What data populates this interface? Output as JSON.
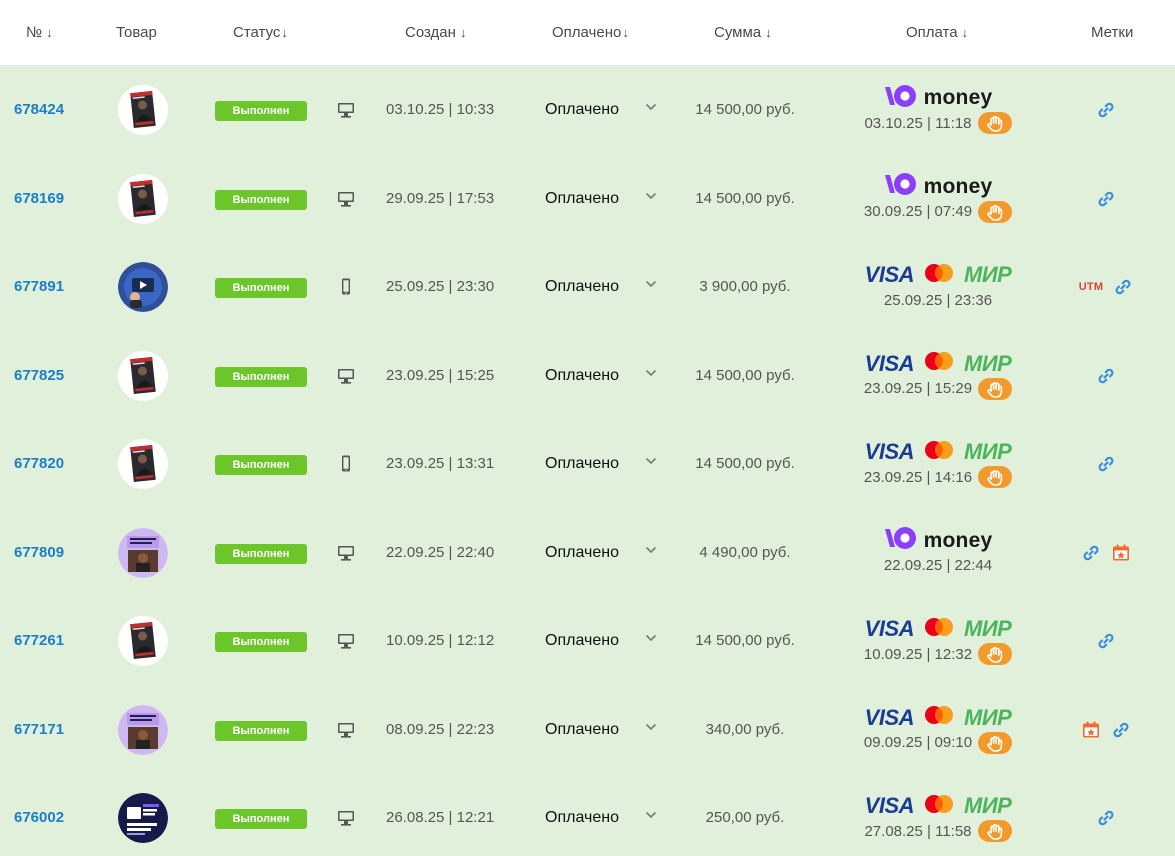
{
  "header": {
    "num": "№",
    "product": "Товар",
    "status": "Статус",
    "created": "Создан",
    "paid": "Оплачено",
    "sum": "Сумма",
    "payment": "Оплата",
    "tags": "Метки",
    "sort_arrow": "↓"
  },
  "colors": {
    "row_bg": "#e1f0da",
    "link": "#1a7fc8",
    "status_green": "#6cc62a",
    "hand_orange": "#f39a2d",
    "ymoney_purple": "#8b3ffd",
    "visa_blue": "#1a3c93",
    "mir_green": "#4db45e",
    "utm_red": "#d7453c"
  },
  "payment_logo_text": {
    "ymoney": "money",
    "visa": "VISA",
    "mir": "МИР",
    "utm": "UTM"
  },
  "rows": [
    {
      "id": "678424",
      "thumb": "book-cover",
      "status": "Выполнен",
      "device": "desktop",
      "created": "03.10.25 | 10:33",
      "paid": "Оплачено",
      "sum": "14 500,00 руб.",
      "method": "ymoney",
      "pay_date": "03.10.25 | 11:18",
      "hand": true,
      "tags": [
        "link"
      ]
    },
    {
      "id": "678169",
      "thumb": "book-cover",
      "status": "Выполнен",
      "device": "desktop",
      "created": "29.09.25 | 17:53",
      "paid": "Оплачено",
      "sum": "14 500,00 руб.",
      "method": "ymoney",
      "pay_date": "30.09.25 | 07:49",
      "hand": true,
      "tags": [
        "link"
      ]
    },
    {
      "id": "677891",
      "thumb": "blue-video",
      "status": "Выполнен",
      "device": "mobile",
      "created": "25.09.25 | 23:30",
      "paid": "Оплачено",
      "sum": "3 900,00 руб.",
      "method": "cards",
      "pay_date": "25.09.25 | 23:36",
      "hand": false,
      "tags": [
        "utm",
        "link"
      ]
    },
    {
      "id": "677825",
      "thumb": "book-cover",
      "status": "Выполнен",
      "device": "desktop",
      "created": "23.09.25 | 15:25",
      "paid": "Оплачено",
      "sum": "14 500,00 руб.",
      "method": "cards",
      "pay_date": "23.09.25 | 15:29",
      "hand": true,
      "tags": [
        "link"
      ]
    },
    {
      "id": "677820",
      "thumb": "book-cover",
      "status": "Выполнен",
      "device": "mobile",
      "created": "23.09.25 | 13:31",
      "paid": "Оплачено",
      "sum": "14 500,00 руб.",
      "method": "cards",
      "pay_date": "23.09.25 | 14:16",
      "hand": true,
      "tags": [
        "link"
      ]
    },
    {
      "id": "677809",
      "thumb": "partner-purple",
      "status": "Выполнен",
      "device": "desktop",
      "created": "22.09.25 | 22:40",
      "paid": "Оплачено",
      "sum": "4 490,00 руб.",
      "method": "ymoney",
      "pay_date": "22.09.25 | 22:44",
      "hand": false,
      "tags": [
        "link",
        "calendar"
      ]
    },
    {
      "id": "677261",
      "thumb": "book-cover",
      "status": "Выполнен",
      "device": "desktop",
      "created": "10.09.25 | 12:12",
      "paid": "Оплачено",
      "sum": "14 500,00 руб.",
      "method": "cards",
      "pay_date": "10.09.25 | 12:32",
      "hand": true,
      "tags": [
        "link"
      ]
    },
    {
      "id": "677171",
      "thumb": "partner-purple",
      "status": "Выполнен",
      "device": "desktop",
      "created": "08.09.25 | 22:23",
      "paid": "Оплачено",
      "sum": "340,00 руб.",
      "method": "cards",
      "pay_date": "09.09.25 | 09:10",
      "hand": true,
      "tags": [
        "calendar",
        "link"
      ]
    },
    {
      "id": "676002",
      "thumb": "notion-dark",
      "status": "Выполнен",
      "device": "desktop",
      "created": "26.08.25 | 12:21",
      "paid": "Оплачено",
      "sum": "250,00 руб.",
      "method": "cards",
      "pay_date": "27.08.25 | 11:58",
      "hand": true,
      "tags": [
        "link"
      ]
    }
  ]
}
